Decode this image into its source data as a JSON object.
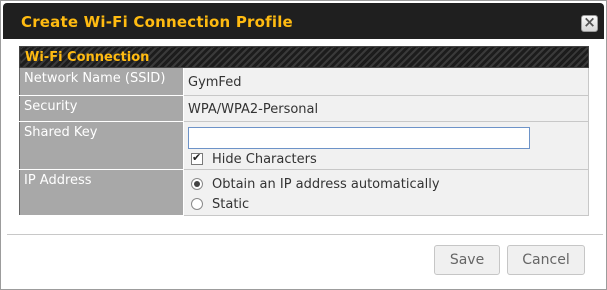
{
  "dialog": {
    "title": "Create Wi-Fi Connection Profile",
    "close_glyph": "×"
  },
  "section": {
    "title": "Wi-Fi Connection"
  },
  "fields": {
    "ssid": {
      "label": "Network Name (SSID)",
      "value": "GymFed"
    },
    "security": {
      "label": "Security",
      "value": "WPA/WPA2-Personal"
    },
    "shared_key": {
      "label": "Shared Key",
      "value": "",
      "hide_characters_label": "Hide Characters",
      "hide_characters_checked": true
    },
    "ip_address": {
      "label": "IP Address",
      "options": [
        {
          "label": "Obtain an IP address automatically",
          "selected": true
        },
        {
          "label": "Static",
          "selected": false
        }
      ]
    }
  },
  "buttons": {
    "save": "Save",
    "cancel": "Cancel"
  },
  "colors": {
    "title_accent": "#ffbb11",
    "label_bg": "#a8a8a8",
    "value_bg": "#f1f1f1"
  },
  "icons": {
    "close": "close-icon",
    "checkbox": "checkmark-icon"
  }
}
